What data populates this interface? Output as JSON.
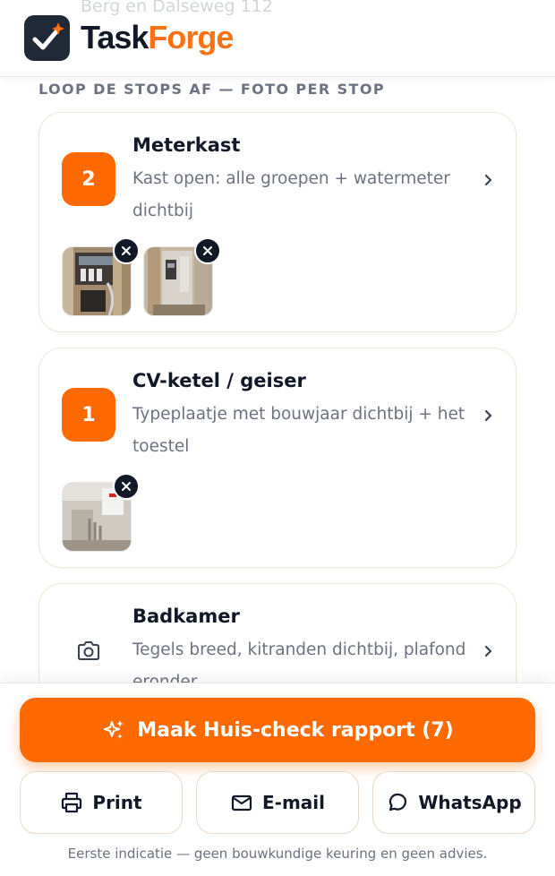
{
  "header": {
    "ghost_address": "Berg en Dalseweg 112",
    "brand_part1": "Task",
    "brand_part2": "Forge",
    "logo_icon": "check-spark-logo-icon"
  },
  "section_label": "LOOP DE STOPS AF — FOTO PER STOP",
  "stops": [
    {
      "badge": "2",
      "title": "Meterkast",
      "description": "Kast open: alle groepen + watermeter dichtbij",
      "photo_count": 2
    },
    {
      "badge": "1",
      "title": "CV-ketel / geiser",
      "description": "Typeplaatje met bouwjaar dichtbij + het toestel",
      "photo_count": 1
    },
    {
      "badge": "",
      "icon": "camera-icon",
      "title": "Badkamer",
      "description": "Tegels breed, kitranden dichtbij, plafond eronder"
    }
  ],
  "actions": {
    "primary_label": "Maak Huis-check rapport (7)",
    "print_label": "Print",
    "email_label": "E-mail",
    "whatsapp_label": "WhatsApp"
  },
  "disclaimer": "Eerste indicatie — geen bouwkundige keuring en geen advies.",
  "colors": {
    "accent": "#ff6a00",
    "brand_dark": "#111827",
    "muted_text": "#6b7280",
    "card_border": "#f1e7d6"
  }
}
